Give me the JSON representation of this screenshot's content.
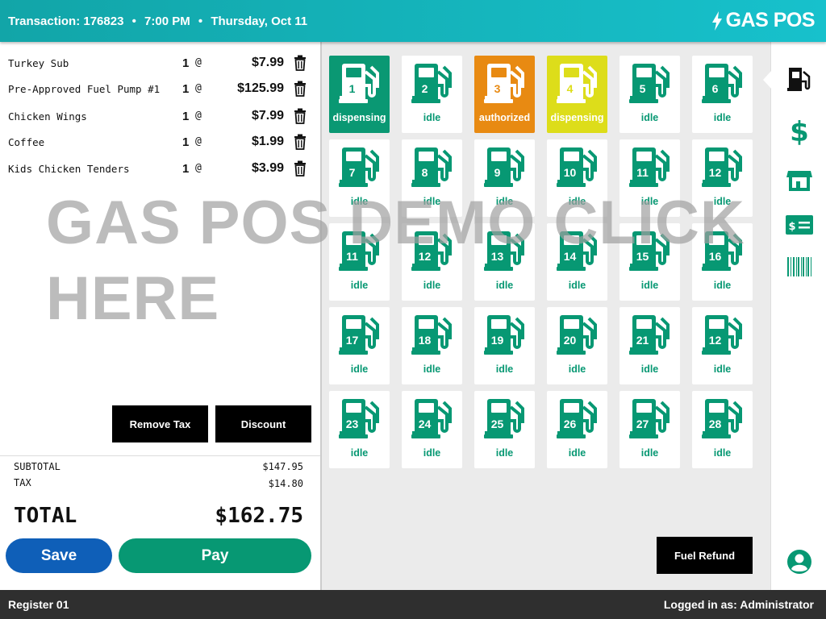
{
  "header": {
    "transaction": "Transaction: 176823",
    "time": "7:00 PM",
    "date": "Thursday, Oct 11",
    "separator": "•",
    "logo_text": "GAS POS"
  },
  "cart": {
    "items": [
      {
        "name": "Turkey Sub",
        "qty": "1",
        "at": "@",
        "price": "$7.99"
      },
      {
        "name": "Pre-Approved Fuel Pump #1",
        "qty": "1",
        "at": "@",
        "price": "$125.99"
      },
      {
        "name": "Chicken Wings",
        "qty": "1",
        "at": "@",
        "price": "$7.99"
      },
      {
        "name": "Coffee",
        "qty": "1",
        "at": "@",
        "price": "$1.99"
      },
      {
        "name": "Kids Chicken Tenders",
        "qty": "1",
        "at": "@",
        "price": "$3.99"
      }
    ],
    "remove_tax_label": "Remove Tax",
    "discount_label": "Discount",
    "subtotal_label": "SUBTOTAL",
    "subtotal_value": "$147.95",
    "tax_label": "TAX",
    "tax_value": "$14.80",
    "total_label": "TOTAL",
    "total_value": "$162.75",
    "save_label": "Save",
    "pay_label": "Pay"
  },
  "pumps": [
    {
      "num": "1",
      "status": "dispensing",
      "color": "#0a9873"
    },
    {
      "num": "2",
      "status": "idle",
      "color": "#ffffff"
    },
    {
      "num": "3",
      "status": "authorized",
      "color": "#e88a12"
    },
    {
      "num": "4",
      "status": "dispensing",
      "color": "#dddd1a"
    },
    {
      "num": "5",
      "status": "idle",
      "color": "#ffffff"
    },
    {
      "num": "6",
      "status": "idle",
      "color": "#ffffff"
    },
    {
      "num": "7",
      "status": "idle",
      "color": "#ffffff"
    },
    {
      "num": "8",
      "status": "idle",
      "color": "#ffffff"
    },
    {
      "num": "9",
      "status": "idle",
      "color": "#ffffff"
    },
    {
      "num": "10",
      "status": "idle",
      "color": "#ffffff"
    },
    {
      "num": "11",
      "status": "idle",
      "color": "#ffffff"
    },
    {
      "num": "12",
      "status": "idle",
      "color": "#ffffff"
    },
    {
      "num": "11",
      "status": "idle",
      "color": "#ffffff"
    },
    {
      "num": "12",
      "status": "idle",
      "color": "#ffffff"
    },
    {
      "num": "13",
      "status": "idle",
      "color": "#ffffff"
    },
    {
      "num": "14",
      "status": "idle",
      "color": "#ffffff"
    },
    {
      "num": "15",
      "status": "idle",
      "color": "#ffffff"
    },
    {
      "num": "16",
      "status": "idle",
      "color": "#ffffff"
    },
    {
      "num": "17",
      "status": "idle",
      "color": "#ffffff"
    },
    {
      "num": "18",
      "status": "idle",
      "color": "#ffffff"
    },
    {
      "num": "19",
      "status": "idle",
      "color": "#ffffff"
    },
    {
      "num": "20",
      "status": "idle",
      "color": "#ffffff"
    },
    {
      "num": "21",
      "status": "idle",
      "color": "#ffffff"
    },
    {
      "num": "12",
      "status": "idle",
      "color": "#ffffff"
    },
    {
      "num": "23",
      "status": "idle",
      "color": "#ffffff"
    },
    {
      "num": "24",
      "status": "idle",
      "color": "#ffffff"
    },
    {
      "num": "25",
      "status": "idle",
      "color": "#ffffff"
    },
    {
      "num": "26",
      "status": "idle",
      "color": "#ffffff"
    },
    {
      "num": "27",
      "status": "idle",
      "color": "#ffffff"
    },
    {
      "num": "28",
      "status": "idle",
      "color": "#ffffff"
    }
  ],
  "fuel_refund_label": "Fuel Refund",
  "sidebar": {
    "icons": [
      "fuel-pump-icon",
      "dollar-icon",
      "store-icon",
      "payment-card-icon",
      "barcode-icon",
      "user-account-icon"
    ]
  },
  "footer": {
    "register": "Register 01",
    "logged_in": "Logged in as: Administrator"
  },
  "watermark": "GAS POS DEMO CLICK HERE",
  "colors": {
    "accent_green": "#0a9873",
    "header_teal": "#17c1cc",
    "save_blue": "#0f5fb8",
    "authorized_orange": "#e88a12",
    "dispensing_yellow": "#dddd1a"
  }
}
